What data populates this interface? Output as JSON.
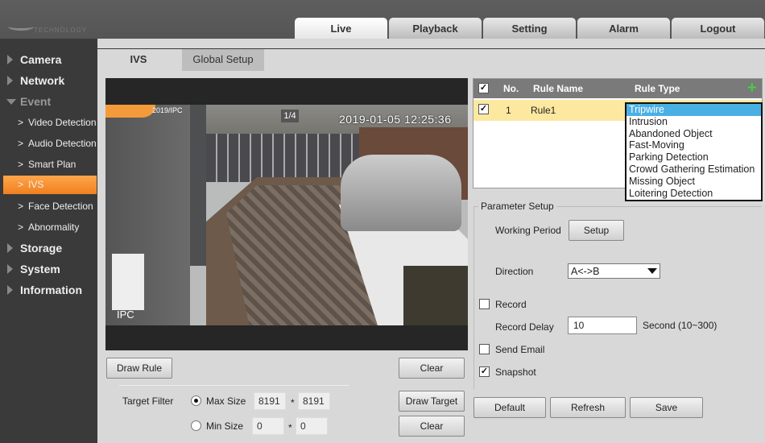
{
  "logo_text": "TECHNOLOGY",
  "top_tabs": [
    {
      "label": "Live",
      "active": true
    },
    {
      "label": "Playback"
    },
    {
      "label": "Setting"
    },
    {
      "label": "Alarm"
    },
    {
      "label": "Logout"
    }
  ],
  "sidebar": {
    "main": [
      "Camera",
      "Network",
      "Event",
      "Storage",
      "System",
      "Information"
    ],
    "event_sub": [
      "Video Detection",
      "Audio Detection",
      "Smart Plan",
      "IVS",
      "Face Detection",
      "Abnormality"
    ],
    "active": "IVS"
  },
  "content_tabs": [
    "IVS",
    "Global Setup"
  ],
  "video": {
    "channel": "1/4",
    "timestamp": "2019-01-05 12:25:36",
    "osd_name": "IPC",
    "osd_title": "2019/IPC"
  },
  "left_buttons": {
    "draw_rule": "Draw Rule",
    "clear": "Clear",
    "draw_target": "Draw Target",
    "clear2": "Clear"
  },
  "target_filter": {
    "label": "Target Filter",
    "max_label": "Max Size",
    "max_w": "8191",
    "max_h": "8191",
    "min_label": "Min Size",
    "min_w": "0",
    "min_h": "0",
    "separator": "*",
    "selected": "Max Size"
  },
  "rule_table": {
    "headers": [
      "No.",
      "Rule Name",
      "Rule Type"
    ],
    "rows": [
      {
        "no": "1",
        "name": "Rule1",
        "checked": true
      }
    ]
  },
  "rule_type_options": [
    "Tripwire",
    "Intrusion",
    "Abandoned Object",
    "Fast-Moving",
    "Parking Detection",
    "Crowd Gathering Estimation",
    "Missing Object",
    "Loitering Detection"
  ],
  "parameter_setup": {
    "title": "Parameter Setup",
    "working_period_label": "Working Period",
    "setup_button": "Setup",
    "direction_label": "Direction",
    "direction_value": "A<->B",
    "record_label": "Record",
    "record_checked": false,
    "record_delay_label": "Record Delay",
    "record_delay_value": "10",
    "record_delay_unit": "Second (10~300)",
    "send_email_label": "Send Email",
    "send_email_checked": false,
    "snapshot_label": "Snapshot",
    "snapshot_checked": true
  },
  "bottom_buttons": {
    "default": "Default",
    "refresh": "Refresh",
    "save": "Save"
  },
  "colors": {
    "accent": "#f39a3a",
    "selection": "#4ab0e4",
    "row_highlight": "#fde8a0"
  }
}
